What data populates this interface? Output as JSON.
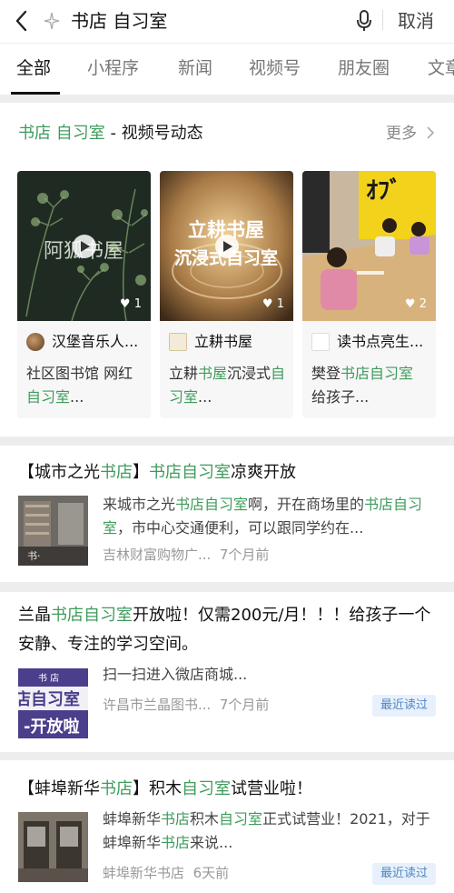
{
  "search": {
    "query": "书店 自习室",
    "cancel_label": "取消"
  },
  "tabs": [
    {
      "label": "全部"
    },
    {
      "label": "小程序"
    },
    {
      "label": "新闻"
    },
    {
      "label": "视频号"
    },
    {
      "label": "朋友圈"
    },
    {
      "label": "文章"
    }
  ],
  "video_section": {
    "title_kw": "书店 自习室",
    "title_rest": " - 视频号动态",
    "more_label": "更多",
    "videos": [
      {
        "thumb_text": "阿狐书屋",
        "likes": "1",
        "author": "汉堡音乐人...",
        "desc": [
          {
            "t": "社区图书馆 网红",
            "hl": false
          },
          {
            "t": "自习室",
            "hl": true
          },
          {
            "t": "...",
            "hl": false
          }
        ]
      },
      {
        "thumb_text": "立耕书屋 沉浸式自习室",
        "likes": "1",
        "author": "立耕书屋",
        "desc": [
          {
            "t": "立耕",
            "hl": false
          },
          {
            "t": "书屋",
            "hl": true
          },
          {
            "t": "沉浸式",
            "hl": false
          },
          {
            "t": "自习室",
            "hl": true
          },
          {
            "t": "...",
            "hl": false
          }
        ]
      },
      {
        "likes": "2",
        "author": "读书点亮生...",
        "desc": [
          {
            "t": "樊登",
            "hl": false
          },
          {
            "t": "书店自习室",
            "hl": true
          },
          {
            "t": " 给孩子...",
            "hl": false
          }
        ]
      }
    ]
  },
  "articles": [
    {
      "title": [
        {
          "t": "【城市之光",
          "hl": false
        },
        {
          "t": "书店",
          "hl": true
        },
        {
          "t": "】",
          "hl": false
        },
        {
          "t": "书店自习室",
          "hl": true
        },
        {
          "t": "凉爽开放",
          "hl": false
        }
      ],
      "snippet": [
        {
          "t": "来城市之光",
          "hl": false
        },
        {
          "t": "书店自习室",
          "hl": true
        },
        {
          "t": "啊，开在商场里的",
          "hl": false
        },
        {
          "t": "书店自习室",
          "hl": true
        },
        {
          "t": "，市中心交通便利，可以跟同学约在...",
          "hl": false
        }
      ],
      "source": "吉林财富购物广...",
      "time": "7个月前",
      "badge": ""
    },
    {
      "title": [
        {
          "t": "兰晶",
          "hl": false
        },
        {
          "t": "书店自习室",
          "hl": true
        },
        {
          "t": "开放啦！仅需200元/月！！！给孩子一个安静、专注的学习空间。",
          "hl": false
        }
      ],
      "snippet": [
        {
          "t": "扫一扫进入微店商城...",
          "hl": false
        }
      ],
      "source": "许昌市兰晶图书...",
      "time": "7个月前",
      "badge": "最近读过",
      "thumb_text": "书 店 店自习室 开放啦"
    },
    {
      "title": [
        {
          "t": "【蚌埠新华",
          "hl": false
        },
        {
          "t": "书店",
          "hl": true
        },
        {
          "t": "】积木",
          "hl": false
        },
        {
          "t": "自习室",
          "hl": true
        },
        {
          "t": "试营业啦！",
          "hl": false
        }
      ],
      "snippet": [
        {
          "t": "蚌埠新华",
          "hl": false
        },
        {
          "t": "书店",
          "hl": true
        },
        {
          "t": "积木",
          "hl": false
        },
        {
          "t": "自习室",
          "hl": true
        },
        {
          "t": "正式试营业！2021，对于蚌埠新华",
          "hl": false
        },
        {
          "t": "书店",
          "hl": true
        },
        {
          "t": "来说...",
          "hl": false
        }
      ],
      "source": "蚌埠新华书店",
      "time": "6天前",
      "badge": "最近读过"
    }
  ],
  "colors": {
    "highlight": "#3f9b5c",
    "badge_bg": "#e8f1fb",
    "badge_text": "#4e86c7"
  }
}
